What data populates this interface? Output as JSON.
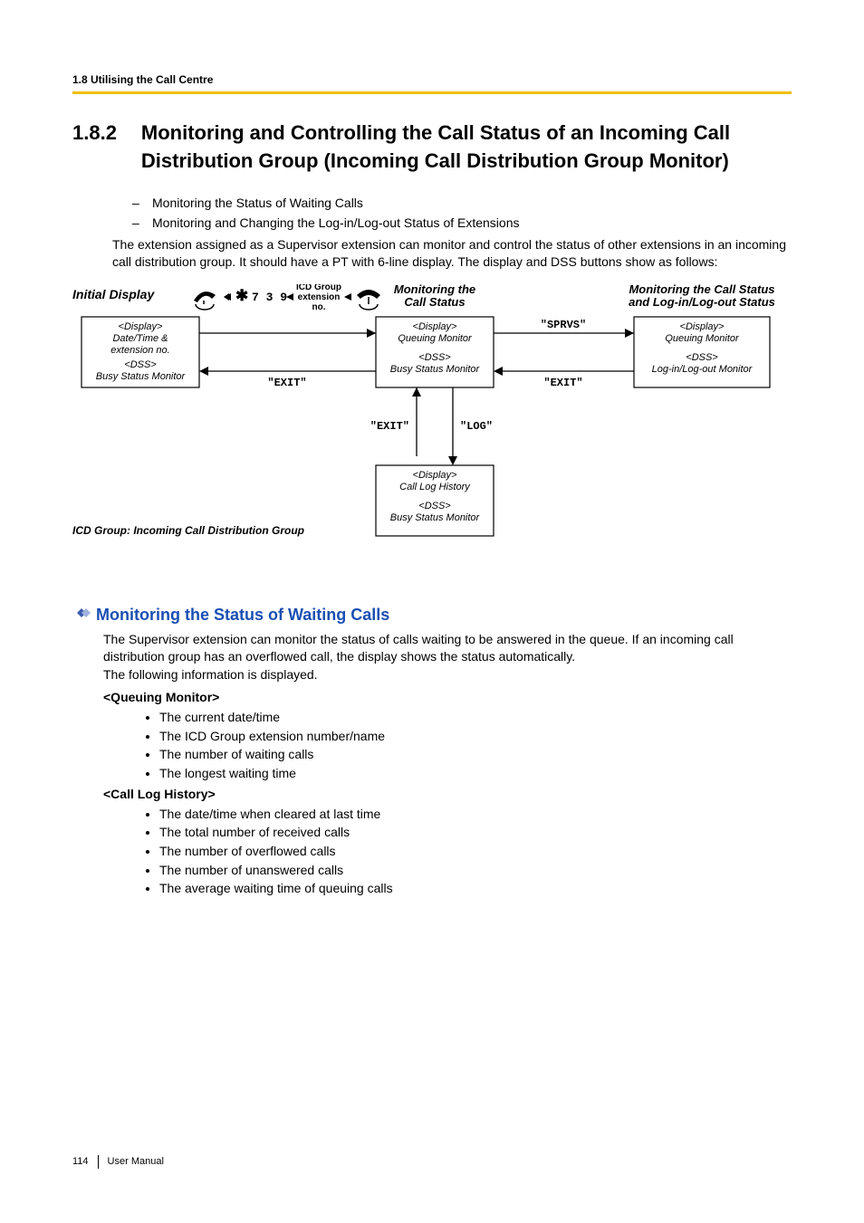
{
  "running_header": "1.8 Utilising the Call Centre",
  "section": {
    "number": "1.8.2",
    "title": "Monitoring and Controlling the Call Status of an Incoming Call Distribution Group (Incoming Call Distribution Group Monitor)"
  },
  "intro_dashes": [
    "Monitoring the Status of Waiting Calls",
    "Monitoring and Changing the Log-in/Log-out Status of Extensions"
  ],
  "intro_para": "The extension assigned as a Supervisor extension can monitor and control the status of other extensions in an incoming call distribution group. It should have a PT with 6-line display. The display and DSS buttons show as follows:",
  "diagram": {
    "initial_display": "Initial Display",
    "monitoring_call_status": "Monitoring the\nCall Status",
    "monitoring_call_loginout": "Monitoring the Call Status\nand Log-in/Log-out Status",
    "step_code": "7 3 9",
    "step_label": "ICD Group\nextension\nno.",
    "box1": {
      "display": "<Display>",
      "line1": "Date/Time &",
      "line2": "extension no.",
      "dss": "<DSS>",
      "line3": "Busy Status Monitor"
    },
    "box2": {
      "display": "<Display>",
      "line1": "Queuing Monitor",
      "dss": "<DSS>",
      "line2": "Busy Status Monitor"
    },
    "box3": {
      "display": "<Display>",
      "line1": "Queuing Monitor",
      "dss": "<DSS>",
      "line2": "Log-in/Log-out Monitor"
    },
    "box4": {
      "display": "<Display>",
      "line1": "Call Log History",
      "dss": "<DSS>",
      "line2": "Busy Status Monitor"
    },
    "labels": {
      "exit": "\"EXIT\"",
      "log": "\"LOG\"",
      "sprvs": "\"SPRVS\""
    },
    "footnote": "ICD Group: Incoming Call Distribution Group"
  },
  "subsection": {
    "title": "Monitoring the Status of Waiting Calls",
    "para": "The Supervisor extension can monitor the status of calls waiting to be answered in the queue. If an incoming call distribution group has an overflowed call, the display shows the status automatically.\nThe following information is displayed.",
    "queuing_label": "<Queuing Monitor>",
    "queuing_items": [
      "The current date/time",
      "The ICD Group extension number/name",
      "The number of waiting calls",
      "The longest waiting time"
    ],
    "calllog_label": "<Call Log History>",
    "calllog_items": [
      "The date/time when cleared at last time",
      "The total number of received calls",
      "The number of overflowed calls",
      "The number of unanswered calls",
      "The average waiting time of queuing calls"
    ]
  },
  "footer": {
    "page": "114",
    "label": "User Manual"
  }
}
